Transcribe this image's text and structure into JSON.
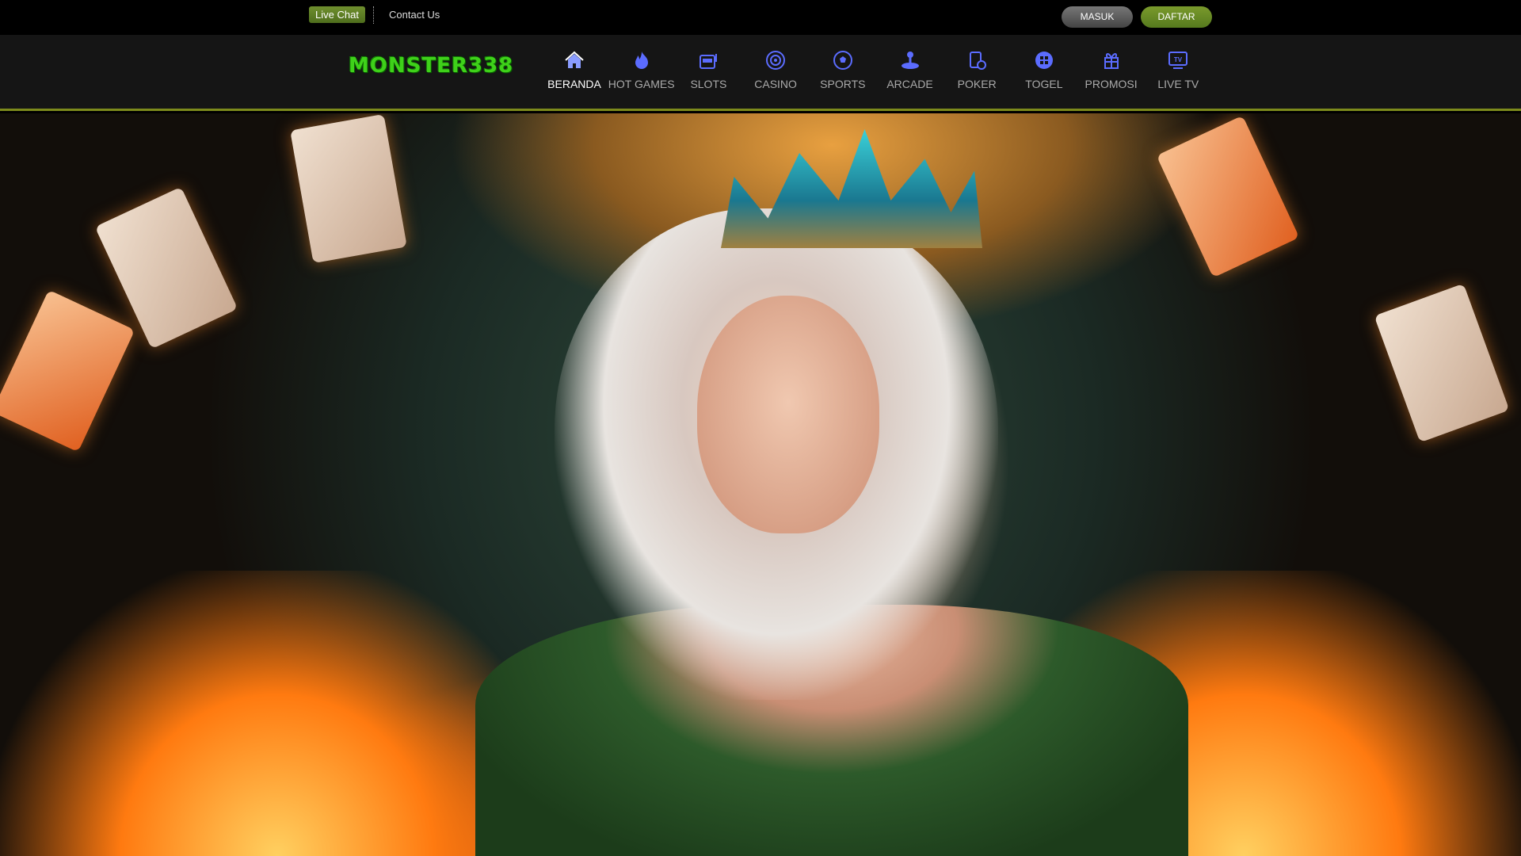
{
  "topbar": {
    "live_chat": "Live Chat",
    "contact_us": "Contact Us",
    "login": "MASUK",
    "register": "DAFTAR"
  },
  "brand": {
    "logo_text": "MONSTER338"
  },
  "nav": [
    {
      "label": "BERANDA",
      "icon": "home-icon",
      "active": true
    },
    {
      "label": "HOT GAMES",
      "icon": "fire-icon"
    },
    {
      "label": "SLOTS",
      "icon": "slot-machine-icon"
    },
    {
      "label": "CASINO",
      "icon": "casino-chip-icon"
    },
    {
      "label": "SPORTS",
      "icon": "soccer-ball-icon"
    },
    {
      "label": "ARCADE",
      "icon": "joystick-icon"
    },
    {
      "label": "POKER",
      "icon": "poker-cards-icon"
    },
    {
      "label": "TOGEL",
      "icon": "lottery-icon"
    },
    {
      "label": "PROMOSI",
      "icon": "gift-icon"
    },
    {
      "label": "LIVE TV",
      "icon": "tv-icon"
    }
  ],
  "colors": {
    "accent": "#6f8f2e",
    "nav_icon": "#5b6cff",
    "nav_border": "#7d8b1c"
  }
}
